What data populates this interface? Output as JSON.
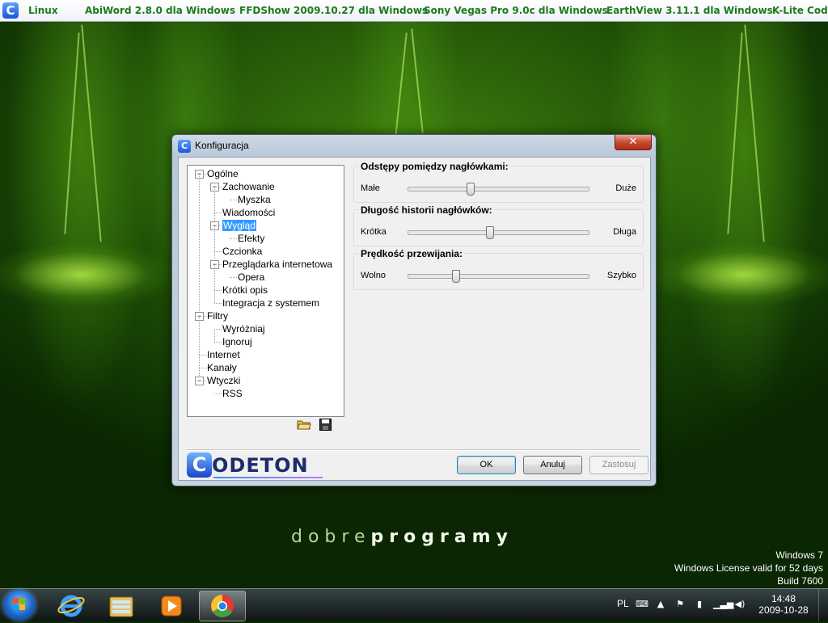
{
  "topbar": {
    "logo_letter": "C",
    "items": [
      "Linux",
      "AbiWord 2.8.0 dla Windows",
      "FFDShow 2009.10.27 dla Windows",
      "Sony Vegas Pro 9.0c dla Windows",
      "EarthView 3.11.1 dla Windows",
      "K-Lite Codec"
    ]
  },
  "window": {
    "title": "Konfiguracja",
    "icon_letter": "C",
    "close_glyph": "✕"
  },
  "tree": [
    {
      "label": "Ogólne",
      "level": 0,
      "expander": "−"
    },
    {
      "label": "Zachowanie",
      "level": 1,
      "expander": "−"
    },
    {
      "label": "Myszka",
      "level": 2
    },
    {
      "label": "Wiadomości",
      "level": 1
    },
    {
      "label": "Wygląd",
      "level": 1,
      "expander": "−",
      "selected": true
    },
    {
      "label": "Efekty",
      "level": 2
    },
    {
      "label": "Czcionka",
      "level": 1
    },
    {
      "label": "Przeglądarka internetowa",
      "level": 1,
      "expander": "−"
    },
    {
      "label": "Opera",
      "level": 2
    },
    {
      "label": "Krótki opis",
      "level": 1
    },
    {
      "label": "Integracja z systemem",
      "level": 1
    },
    {
      "label": "Filtry",
      "level": 0,
      "expander": "−"
    },
    {
      "label": "Wyróżniaj",
      "level": 1
    },
    {
      "label": "Ignoruj",
      "level": 1
    },
    {
      "label": "Internet",
      "level": 0
    },
    {
      "label": "Kanały",
      "level": 0
    },
    {
      "label": "Wtyczki",
      "level": 0,
      "expander": "−"
    },
    {
      "label": "RSS",
      "level": 1
    }
  ],
  "tree_toolbar": {
    "open_icon": "folder-open-icon",
    "save_icon": "save-icon"
  },
  "settings": {
    "spacing": {
      "title": "Odstępy pomiędzy nagłówkami:",
      "min": "Małe",
      "max": "Duże",
      "value": 0.34
    },
    "history": {
      "title": "Długość historii nagłówków:",
      "min": "Krótka",
      "max": "Długa",
      "value": 0.45
    },
    "scroll": {
      "title": "Prędkość przewijania:",
      "min": "Wolno",
      "max": "Szybko",
      "value": 0.26
    }
  },
  "logo": {
    "letter": "C",
    "rest": "ODETON"
  },
  "buttons": {
    "ok": "OK",
    "cancel": "Anuluj",
    "apply": "Zastosuj"
  },
  "desktop": {
    "brand_light": "dobre",
    "brand_bold": "programy",
    "os_name": "Windows 7",
    "license": "Windows License valid for 52 days",
    "build": "Build 7600"
  },
  "taskbar": {
    "language": "PL",
    "time": "14:48",
    "date": "2009-10-28",
    "apps": [
      "internet-explorer-icon",
      "file-explorer-icon",
      "media-player-icon",
      "chrome-icon"
    ]
  }
}
